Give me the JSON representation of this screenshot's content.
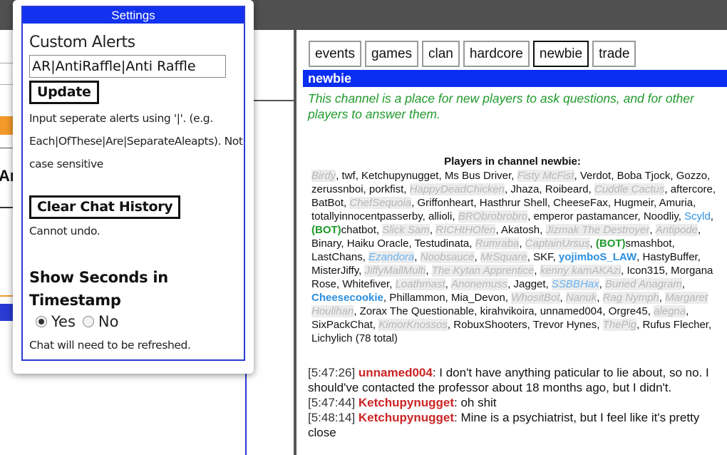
{
  "settings": {
    "title": "Settings",
    "custom_alerts_label": "Custom Alerts",
    "alerts_input_value": "AR|AntiRaffle|Anti Raffle",
    "update_label": "Update",
    "help_text": "Input seperate alerts using '|'. (e.g. Each|OfThese|Are|SeparateAleарts). Not case sensitive",
    "clear_history_label": "Clear Chat History",
    "cannot_undo": "Cannot undo.",
    "seconds_heading": "Show Seconds in Timestamp",
    "yes_label": "Yes",
    "no_label": "No",
    "refresh_note": "Chat will need to be refreshed."
  },
  "background": {
    "fragment_text": "Ar"
  },
  "chat": {
    "tabs": [
      "events",
      "games",
      "clan",
      "hardcore",
      "newbie",
      "trade"
    ],
    "active_tab": "newbie",
    "channel_name": "newbie",
    "channel_description": "This channel is a place for new players to ask questions, and for other players to answer them.",
    "players_title": "Players in channel newbie:",
    "players": [
      {
        "name": "Birdy",
        "style": "away"
      },
      {
        "name": "twf",
        "style": "normal"
      },
      {
        "name": "Ketchupynugget",
        "style": "normal"
      },
      {
        "name": "Ms Bus Driver",
        "style": "normal"
      },
      {
        "name": "Fisty McFist",
        "style": "away"
      },
      {
        "name": "Verdot",
        "style": "normal"
      },
      {
        "name": "Boba Tjock",
        "style": "normal"
      },
      {
        "name": "Gozzo",
        "style": "normal"
      },
      {
        "name": "zerussnboi",
        "style": "normal"
      },
      {
        "name": "porkfist",
        "style": "normal"
      },
      {
        "name": "HappyDeadChicken",
        "style": "away"
      },
      {
        "name": "Jhaza",
        "style": "normal"
      },
      {
        "name": "Roibeard",
        "style": "normal"
      },
      {
        "name": "Cuddle Cactus",
        "style": "away"
      },
      {
        "name": "aftercore",
        "style": "normal"
      },
      {
        "name": "BatBot",
        "style": "normal"
      },
      {
        "name": "ChefSequoia",
        "style": "away"
      },
      {
        "name": "Griffonheart",
        "style": "normal"
      },
      {
        "name": "Hasthrur Shell",
        "style": "normal"
      },
      {
        "name": "CheeseFax",
        "style": "normal"
      },
      {
        "name": "Hugmeir",
        "style": "normal"
      },
      {
        "name": "Amuria",
        "style": "normal"
      },
      {
        "name": "totallyinnocentpasserby",
        "style": "normal"
      },
      {
        "name": "allioli",
        "style": "normal"
      },
      {
        "name": "BRObrobrobro",
        "style": "away"
      },
      {
        "name": "emperor pastamancer",
        "style": "normal"
      },
      {
        "name": "Noodliy",
        "style": "normal"
      },
      {
        "name": "Scyld",
        "style": "blue"
      },
      {
        "name": "chatbot",
        "style": "bot"
      },
      {
        "name": "Slick Sam",
        "style": "away"
      },
      {
        "name": "RICHtHOfen",
        "style": "away"
      },
      {
        "name": "Akatosh",
        "style": "normal"
      },
      {
        "name": "Jizmak The Destroyer",
        "style": "away"
      },
      {
        "name": "Antipode",
        "style": "away"
      },
      {
        "name": "Binary",
        "style": "normal"
      },
      {
        "name": "Haiku Oracle",
        "style": "normal"
      },
      {
        "name": "Testudinata",
        "style": "normal"
      },
      {
        "name": "Rumraba",
        "style": "away"
      },
      {
        "name": "CaptainUrsus",
        "style": "away"
      },
      {
        "name": "smashbot",
        "style": "bot"
      },
      {
        "name": "LastChans",
        "style": "normal"
      },
      {
        "name": "Ezandora",
        "style": "awayblue"
      },
      {
        "name": "Noobsauce",
        "style": "away"
      },
      {
        "name": "MrSquare",
        "style": "away"
      },
      {
        "name": "SKF",
        "style": "normal"
      },
      {
        "name": "yojimboS_LAW",
        "style": "bluebold"
      },
      {
        "name": "HastyBuffer",
        "style": "normal"
      },
      {
        "name": "MisterJiffy",
        "style": "normal"
      },
      {
        "name": "JiffyMallMulti",
        "style": "away"
      },
      {
        "name": "The Kytan Apprentice",
        "style": "away"
      },
      {
        "name": "kenny kamAKAzi",
        "style": "away"
      },
      {
        "name": "Icon315",
        "style": "normal"
      },
      {
        "name": "Morgana Rose",
        "style": "normal"
      },
      {
        "name": "Whitefiver",
        "style": "normal"
      },
      {
        "name": "Loathmast",
        "style": "away"
      },
      {
        "name": "Anonemuss",
        "style": "away"
      },
      {
        "name": "Jagget",
        "style": "normal"
      },
      {
        "name": "SSBBHax",
        "style": "awayblue"
      },
      {
        "name": "Buried Anagram",
        "style": "away"
      },
      {
        "name": "Cheesecookie",
        "style": "bluebold"
      },
      {
        "name": "Phillammon",
        "style": "normal"
      },
      {
        "name": "Mia_Devon",
        "style": "normal"
      },
      {
        "name": "WhositBot",
        "style": "away"
      },
      {
        "name": "Nanuk",
        "style": "away"
      },
      {
        "name": "Rag Nymph",
        "style": "away"
      },
      {
        "name": "Margaret Houlihan",
        "style": "away"
      },
      {
        "name": "Zorax The Questionable",
        "style": "normal"
      },
      {
        "name": "kirahvikoira",
        "style": "normal"
      },
      {
        "name": "unnamed004",
        "style": "normal"
      },
      {
        "name": "Orgre45",
        "style": "normal"
      },
      {
        "name": "alegna",
        "style": "away"
      },
      {
        "name": "SixPackChat",
        "style": "normal"
      },
      {
        "name": "KimorKnossos",
        "style": "away"
      },
      {
        "name": "RobuxShooters",
        "style": "normal"
      },
      {
        "name": "Trevor Hynes",
        "style": "normal"
      },
      {
        "name": "ThePig",
        "style": "away"
      },
      {
        "name": "Rufus Flecher",
        "style": "normal"
      },
      {
        "name": "Lichylich",
        "style": "normal"
      }
    ],
    "bot_prefix": "(BOT)",
    "players_total": "(78 total)",
    "messages": [
      {
        "time": "[5:47:26]",
        "user": "unnamed004",
        "text": ": I don't have anything paticular to lie about, so no. I should've contacted the professor about 18 months ago, but I didn't."
      },
      {
        "time": "[5:47:44]",
        "user": "Ketchupynugget",
        "text": ": oh shit"
      },
      {
        "time": "[5:48:14]",
        "user": "Ketchupynugget",
        "text": ": Mine is a psychiatrist, but I feel like it's pretty close"
      }
    ]
  }
}
